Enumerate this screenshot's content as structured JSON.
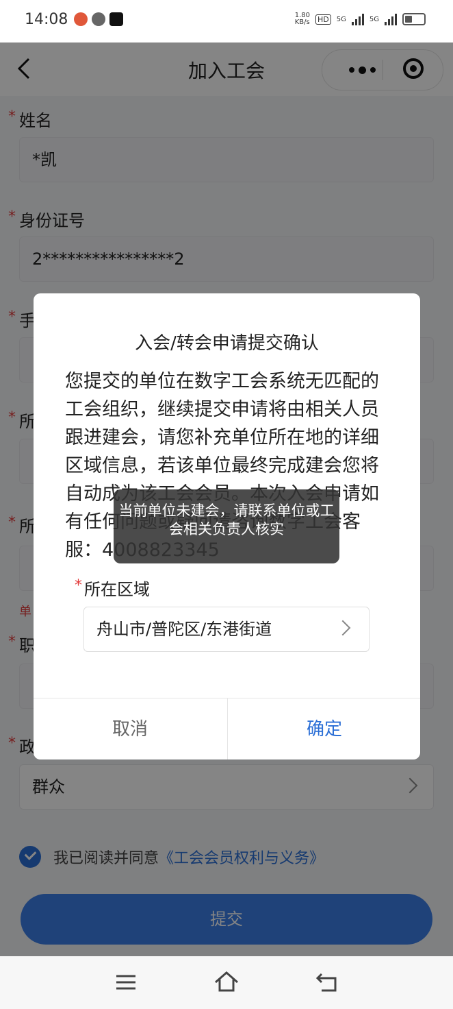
{
  "status_bar": {
    "time": "14:08",
    "net_speed": "1.80\nKB/s",
    "hd": "HD",
    "net1": "5G",
    "net2": "5G"
  },
  "nav": {
    "title": "加入工会"
  },
  "form": {
    "name_label": "姓名",
    "name_value": "*凯",
    "id_label": "身份证号",
    "id_value": "2****************2",
    "phone_label": "手",
    "unit_label": "所",
    "area_label": "所",
    "hint_label": "单",
    "job_label": "职",
    "political_label": "政",
    "political_value": "群众"
  },
  "agree": {
    "text": "我已阅读并同意",
    "link": "《工会会员权利与义务》"
  },
  "submit_label": "提交",
  "dialog": {
    "title": "入会/转会申请提交确认",
    "body": "您提交的单位在数字工会系统无匹配的工会组织，继续提交申请将由相关人员跟进建会，请您补充单位所在地的详细区域信息，若该单位最终完成建会您将自动成为该工会会员。本次入会申请如有任何问题或疑问请咨询数字工会客服：4008823345",
    "region_label": "所在区域",
    "region_value": "舟山市/普陀区/东港街道",
    "cancel": "取消",
    "confirm": "确定"
  },
  "toast": "当前单位未建会，请联系单位或工会相关负责人核实",
  "colors": {
    "accent": "#2b6fd6",
    "required": "#e23a3a",
    "button": "#3c7fe8"
  }
}
